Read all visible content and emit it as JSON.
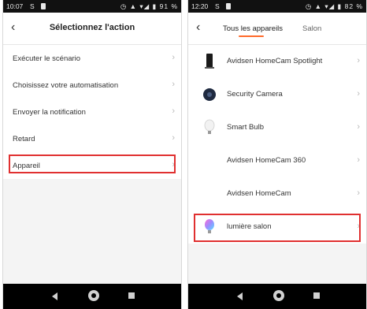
{
  "left_screen": {
    "status_bar": {
      "time": "10:07",
      "left_glyph": "S",
      "right": "91 %"
    },
    "header": {
      "title": "Sélectionnez l'action"
    },
    "items": [
      {
        "label": "Exécuter le scénario"
      },
      {
        "label": "Choisissez votre automatisation"
      },
      {
        "label": "Envoyer la notification"
      },
      {
        "label": "Retard"
      },
      {
        "label": "Appareil"
      }
    ],
    "highlight_color": "#e03030"
  },
  "right_screen": {
    "status_bar": {
      "time": "12:20",
      "left_glyph": "S",
      "right": "82 %"
    },
    "tabs": [
      {
        "label": "Tous les appareils",
        "active": true
      },
      {
        "label": "Salon",
        "active": false
      }
    ],
    "accent_color": "#ff6a2a",
    "devices": [
      {
        "label": "Avidsen HomeCam Spotlight",
        "icon": "spotlight-camera-icon"
      },
      {
        "label": "Security Camera",
        "icon": "dome-camera-icon"
      },
      {
        "label": "Smart Bulb",
        "icon": "bulb-icon"
      },
      {
        "label": "Avidsen HomeCam 360",
        "icon": ""
      },
      {
        "label": "Avidsen HomeCam",
        "icon": ""
      },
      {
        "label": "lumière salon",
        "icon": "color-bulb-icon"
      }
    ]
  }
}
